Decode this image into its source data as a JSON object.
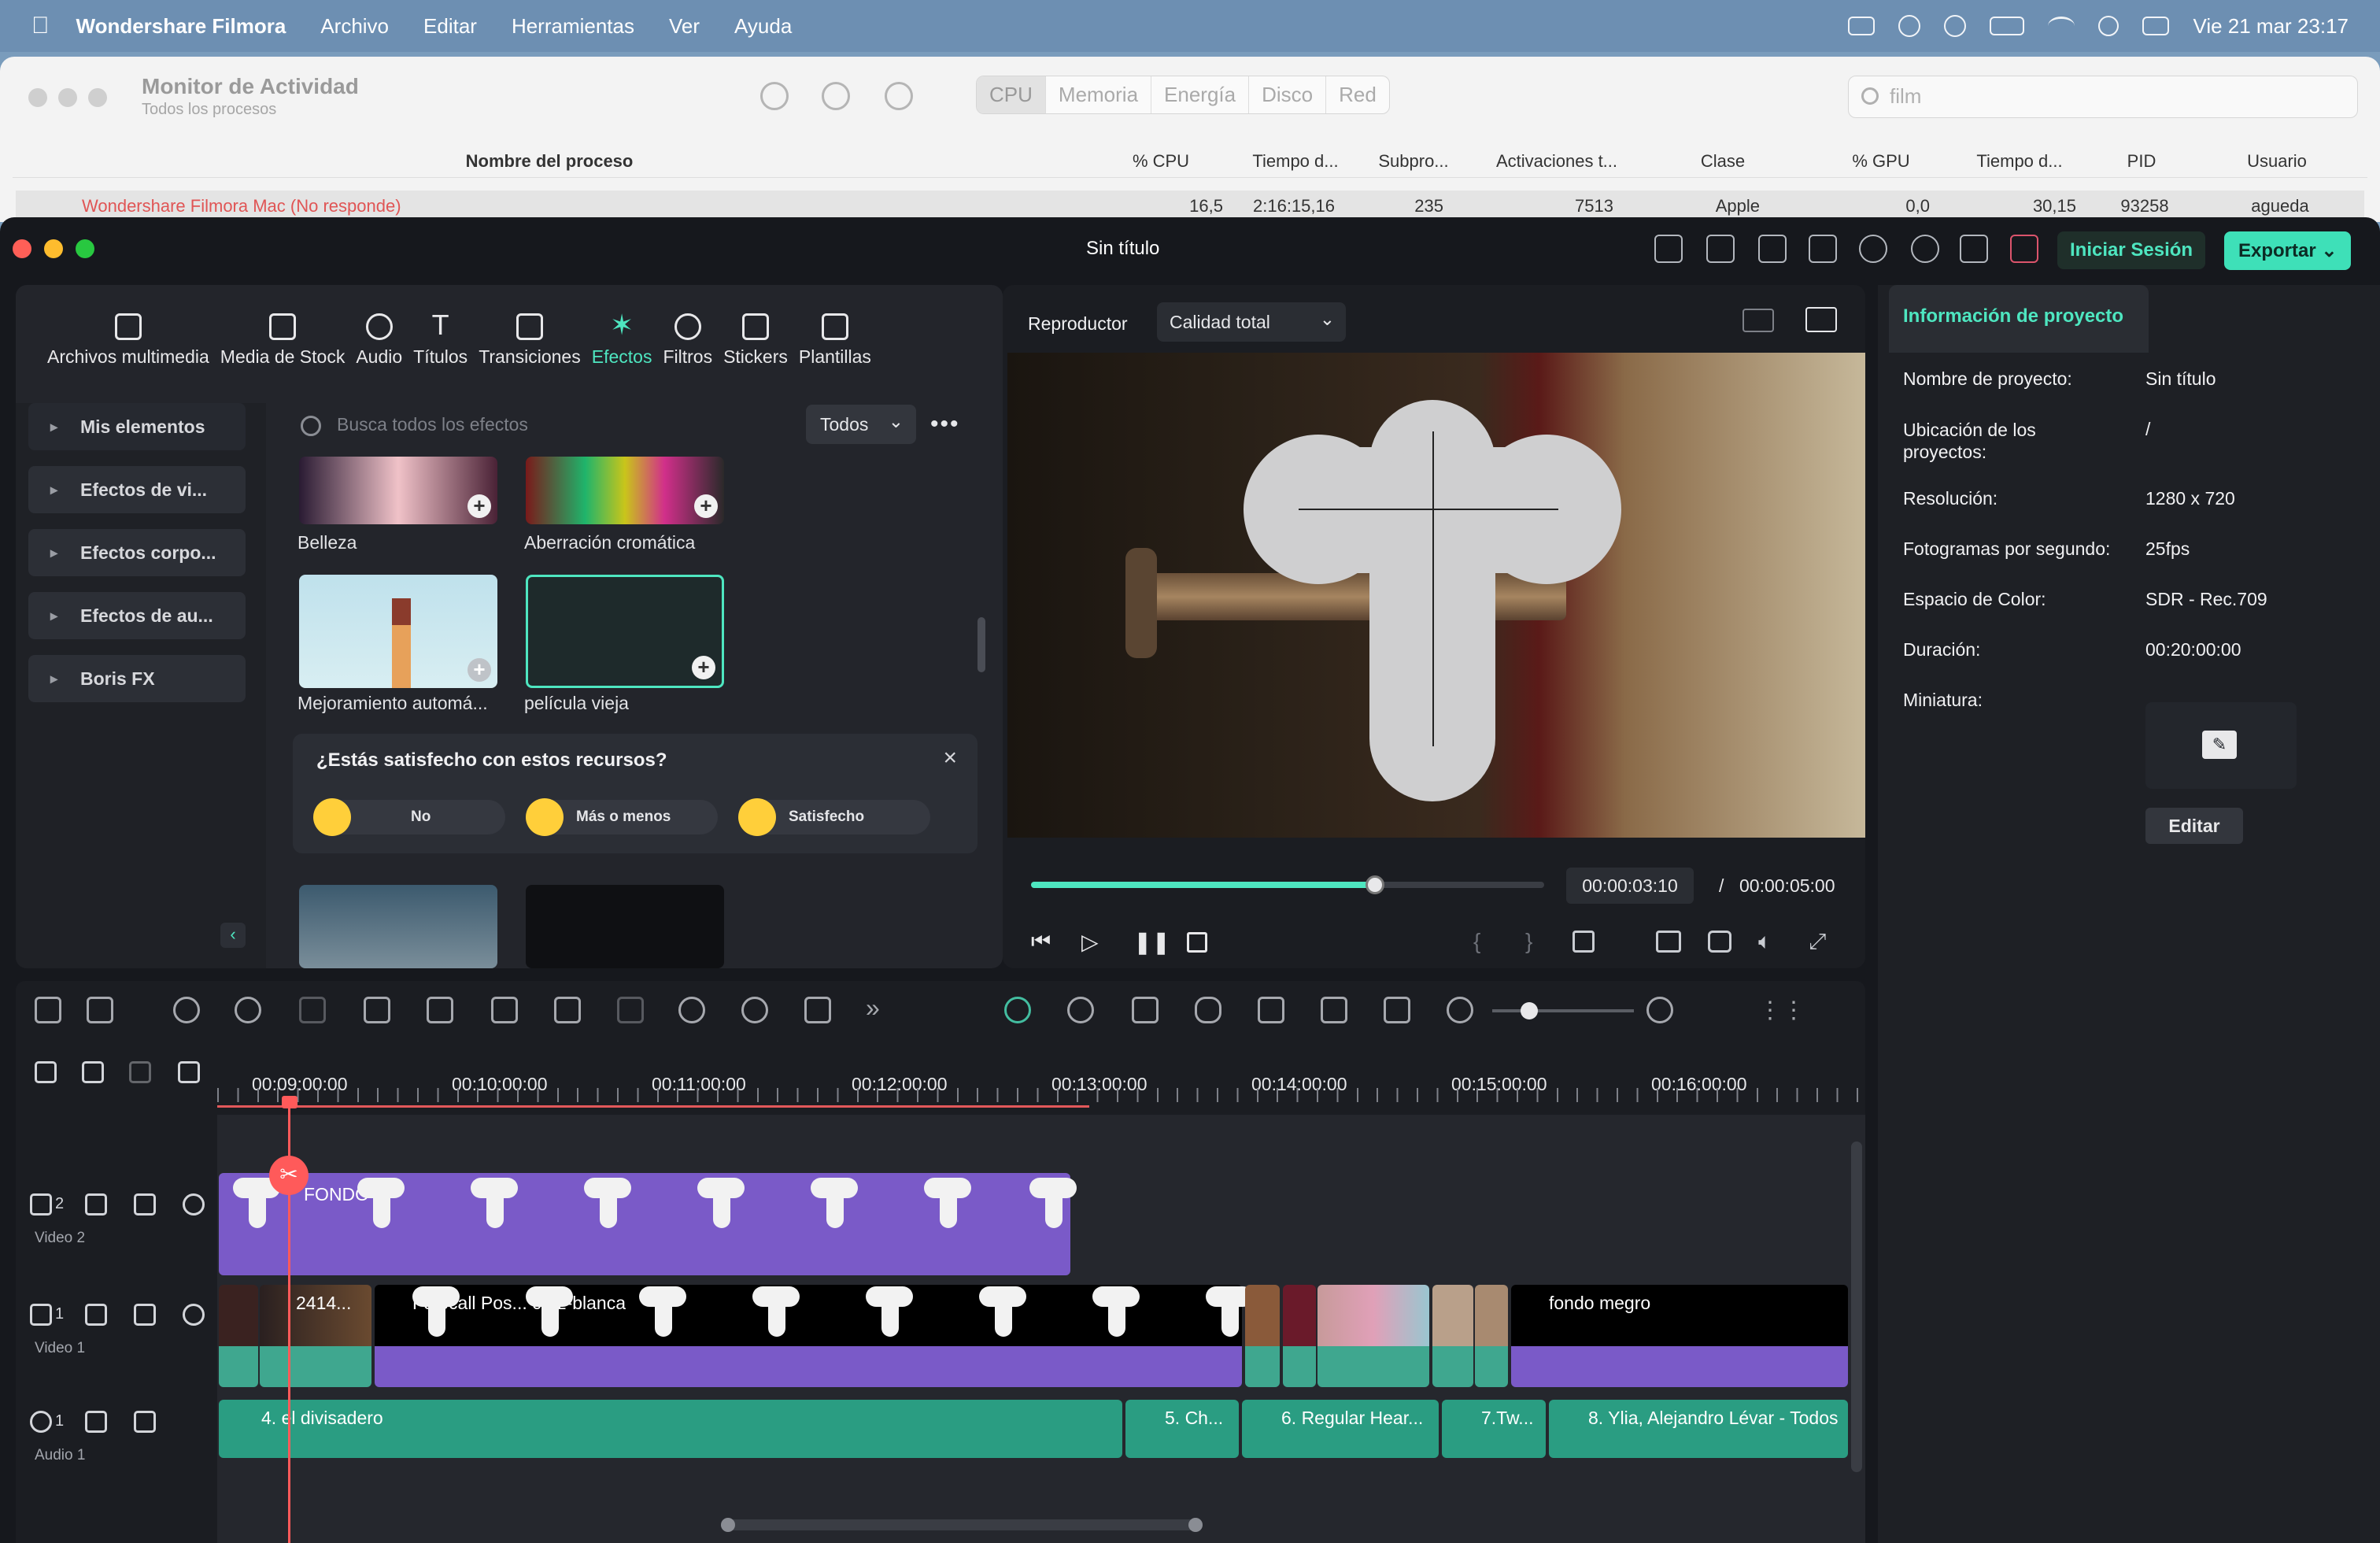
{
  "menubar": {
    "app": "Wondershare Filmora",
    "items": [
      "Archivo",
      "Editar",
      "Herramientas",
      "Ver",
      "Ayuda"
    ],
    "clock": "Vie 21 mar  23:17"
  },
  "activity_monitor": {
    "title": "Monitor de Actividad",
    "subtitle": "Todos los procesos",
    "segments": [
      "CPU",
      "Memoria",
      "Energía",
      "Disco",
      "Red"
    ],
    "selected_segment": "CPU",
    "search_value": "film",
    "columns": [
      "Nombre del proceso",
      "% CPU",
      "Tiempo d...",
      "Subpro...",
      "Activaciones t...",
      "Clase",
      "% GPU",
      "Tiempo d...",
      "PID",
      "Usuario"
    ],
    "row": [
      "Wondershare Filmora Mac (No responde)",
      "16,5",
      "2:16:15,16",
      "235",
      "7513",
      "Apple",
      "0,0",
      "30,15",
      "93258",
      "agueda"
    ]
  },
  "filmora": {
    "title": "Sin título",
    "login": "Iniciar Sesión",
    "export": "Exportar",
    "tabs": [
      "Archivos multimedia",
      "Media de Stock",
      "Audio",
      "Títulos",
      "Transiciones",
      "Efectos",
      "Filtros",
      "Stickers",
      "Plantillas"
    ],
    "active_tab": "Efectos",
    "sidebar": [
      "Mis elementos",
      "Efectos de vi...",
      "Efectos corpo...",
      "Efectos de au...",
      "Boris FX"
    ],
    "search_placeholder": "Busca todos los efectos",
    "filter": "Todos",
    "effects": [
      "Belleza",
      "Aberración cromática",
      "Mejoramiento automá...",
      "película vieja"
    ],
    "satisfaction": {
      "question": "¿Estás satisfecho con estos recursos?",
      "options": [
        "No",
        "Más o menos",
        "Satisfecho"
      ]
    },
    "player": {
      "label": "Reproductor",
      "quality": "Calidad total",
      "current": "00:00:03:10",
      "separator": "/",
      "total": "00:00:05:00",
      "progress": 0.67
    },
    "project_info": {
      "tab": "Información de proyecto",
      "fields": [
        {
          "label": "Nombre de proyecto:",
          "value": "Sin título"
        },
        {
          "label": "Ubicación de los proyectos:",
          "value": "/"
        },
        {
          "label": "Resolución:",
          "value": "1280 x 720"
        },
        {
          "label": "Fotogramas por segundo:",
          "value": "25fps"
        },
        {
          "label": "Espacio de Color:",
          "value": "SDR - Rec.709"
        },
        {
          "label": "Duración:",
          "value": "00:20:00:00"
        },
        {
          "label": "Miniatura:",
          "value": ""
        }
      ],
      "edit": "Editar"
    },
    "timeline": {
      "ruler": [
        "00:09:00:00",
        "00:10:00:00",
        "00:11:00:00",
        "00:12:00:00",
        "00:13:00:00",
        "00:14:00:00",
        "00:15:00:00",
        "00:16:00:00"
      ],
      "tracks": [
        {
          "num": "2",
          "name": "Video 2"
        },
        {
          "num": "1",
          "name": "Video 1"
        },
        {
          "num": "1",
          "name": "Audio 1"
        }
      ],
      "clips": {
        "v2": "FONDO",
        "v1a": "2414...",
        "v1b": "Fotocall Pos... cruz-blanca",
        "v1c": "fondo megro",
        "a1": "4. el divisadero",
        "a2": "5. Ch...",
        "a3": "6. Regular Hear...",
        "a4": "7.Tw...",
        "a5": "8. Ylia, Alejandro Lévar - Todos"
      }
    }
  }
}
